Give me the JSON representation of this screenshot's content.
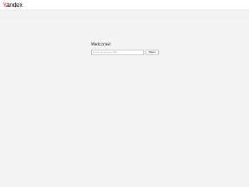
{
  "header": {
    "logo": {
      "first_letter": "Y",
      "rest": "andex"
    }
  },
  "main": {
    "welcome_title": "Welcome!",
    "url_input": {
      "value": "",
      "placeholder": "Enter document URL"
    },
    "open_button_label": "Open"
  },
  "colors": {
    "background": "#f5f4f2",
    "header_background": "#ffffff",
    "logo_accent": "#ff0000",
    "input_border": "#b9b7b2"
  }
}
